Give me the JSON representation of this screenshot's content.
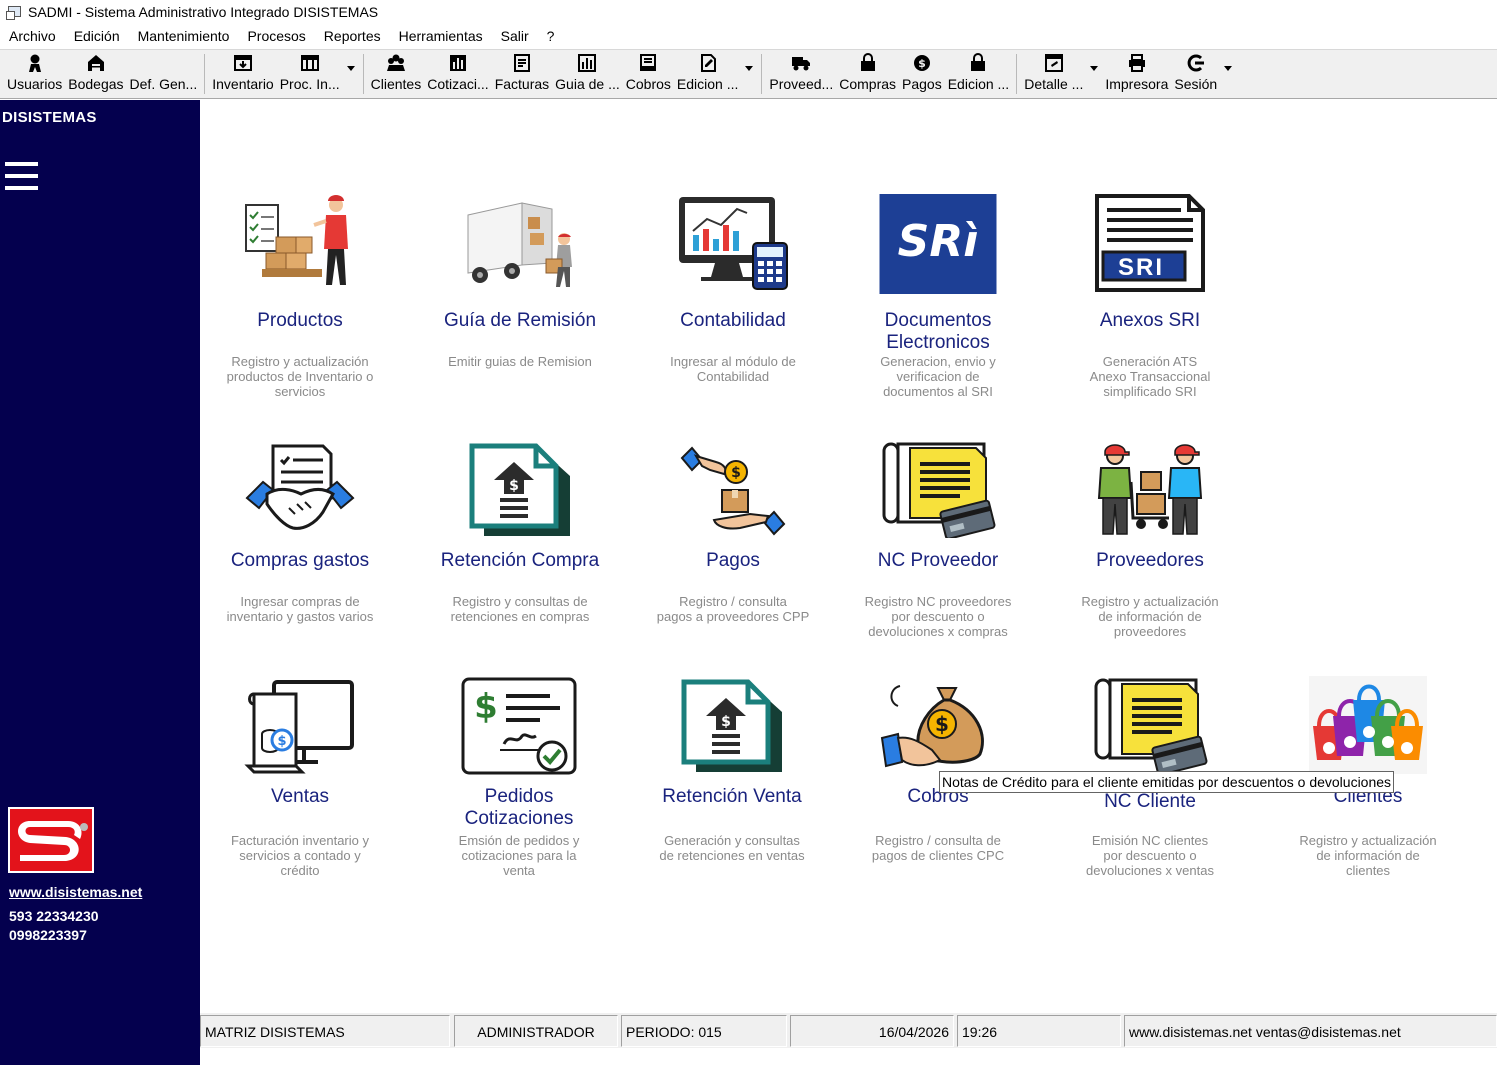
{
  "window": {
    "title": "SADMI - Sistema Administrativo Integrado DISISTEMAS"
  },
  "menu": [
    "Archivo",
    "Edición",
    "Mantenimiento",
    "Procesos",
    "Reportes",
    "Herramientas",
    "Salir",
    "?"
  ],
  "toolbar": {
    "usuarios": "Usuarios",
    "bodegas": "Bodegas",
    "defgen": "Def. Gen...",
    "inventario": "Inventario",
    "procin": "Proc. In...",
    "clientes": "Clientes",
    "cotizaci": "Cotizaci...",
    "facturas": "Facturas",
    "guiade": "Guia de ...",
    "cobros": "Cobros",
    "edicion1": "Edicion ...",
    "proveed": "Proveed...",
    "compras": "Compras",
    "pagos": "Pagos",
    "edicion2": "Edicion ...",
    "detalle": "Detalle ...",
    "impresora": "Impresora",
    "sesion": "Sesión"
  },
  "sidebar": {
    "brand": "DISISTEMAS",
    "website": "www.disistemas.net",
    "phone1": "593 22334230",
    "phone2": "0998223397",
    "colors": {
      "background": "#04004e",
      "logo_red": "#e3131b"
    }
  },
  "tiles": {
    "productos": {
      "title": "Productos",
      "desc": [
        "Registro y actualización",
        "productos de Inventario o",
        "servicios"
      ]
    },
    "guia": {
      "title": "Guía de Remisión",
      "desc": [
        "Emitir guias de Remision"
      ]
    },
    "contabilidad": {
      "title": "Contabilidad",
      "desc": [
        "Ingresar al módulo de",
        "Contabilidad"
      ]
    },
    "documentos": {
      "title1": "Documentos",
      "title2": "Electronicos",
      "desc": [
        "Generacion, envio y",
        "verificacion de",
        "documentos al SRI"
      ],
      "logo_text": "SRì"
    },
    "anexos": {
      "title": "Anexos SRI",
      "desc": [
        "Generación ATS",
        "Anexo Transaccional",
        "simplificado SRI"
      ],
      "badge_text": "SRI"
    },
    "compras": {
      "title": "Compras gastos",
      "desc": [
        "Ingresar compras de",
        "inventario y gastos varios"
      ]
    },
    "retencion_compra": {
      "title": "Retención Compra",
      "desc": [
        "Registro y consultas de",
        "retenciones en compras"
      ]
    },
    "pagos": {
      "title": "Pagos",
      "desc": [
        "Registro / consulta",
        "pagos a proveedores CPP"
      ]
    },
    "nc_proveedor": {
      "title": "NC Proveedor",
      "desc": [
        "Registro NC proveedores",
        "por descuento o",
        "devoluciones x compras"
      ]
    },
    "proveedores": {
      "title": "Proveedores",
      "desc": [
        "Registro y actualización",
        "de información de",
        "proveedores"
      ]
    },
    "ventas": {
      "title": "Ventas",
      "desc": [
        "Facturación inventario y",
        "servicios a contado y",
        "crédito"
      ]
    },
    "pedidos": {
      "title1": "Pedidos",
      "title2": "Cotizaciones",
      "desc": [
        "Emsión de pedidos y",
        "cotizaciones para la",
        "venta"
      ]
    },
    "retencion_venta": {
      "title": "Retención Venta",
      "desc": [
        "Generación y consultas",
        "de retenciones en ventas"
      ]
    },
    "cobros": {
      "title": "Cobros",
      "desc": [
        "Registro / consulta de",
        "pagos de clientes CPC"
      ]
    },
    "nc_cliente": {
      "title": "NC Cliente",
      "desc": [
        "Emisión NC clientes",
        "por descuento o",
        "devoluciones x ventas"
      ]
    },
    "clientes": {
      "title": "Clientes",
      "desc": [
        "Registro y actualización",
        "de información de",
        "clientes"
      ]
    }
  },
  "tooltip": "Notas de Crédito para el cliente emitidas por descuentos o devoluciones",
  "status": {
    "empresa": "MATRIZ DISISTEMAS",
    "usuario": "ADMINISTRADOR",
    "periodo": "PERIODO: 015",
    "fecha": "16/04/2026",
    "hora": "19:26",
    "contacto": "www.disistemas.net  ventas@disistemas.net"
  }
}
